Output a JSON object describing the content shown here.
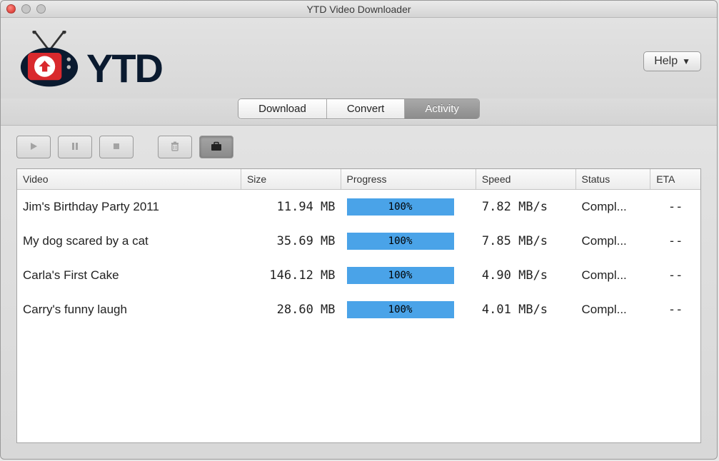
{
  "window": {
    "title": "YTD Video Downloader"
  },
  "header": {
    "brand": "YTD",
    "help_label": "Help"
  },
  "tabs": [
    {
      "label": "Download"
    },
    {
      "label": "Convert"
    },
    {
      "label": "Activity",
      "active": true
    }
  ],
  "toolbar": {
    "play": "play-icon",
    "pause": "pause-icon",
    "stop": "stop-icon",
    "trash": "trash-icon",
    "clear": "clear-all-icon"
  },
  "table": {
    "headers": {
      "video": "Video",
      "size": "Size",
      "progress": "Progress",
      "speed": "Speed",
      "status": "Status",
      "eta": "ETA"
    },
    "rows": [
      {
        "video": "Jim's Birthday Party 2011",
        "size": "11.94 MB",
        "progress": "100%",
        "speed": "7.82 MB/s",
        "status": "Compl...",
        "eta": "--"
      },
      {
        "video": "My dog scared by a cat",
        "size": "35.69 MB",
        "progress": "100%",
        "speed": "7.85 MB/s",
        "status": "Compl...",
        "eta": "--"
      },
      {
        "video": "Carla's First Cake",
        "size": "146.12 MB",
        "progress": "100%",
        "speed": "4.90 MB/s",
        "status": "Compl...",
        "eta": "--"
      },
      {
        "video": "Carry's funny laugh",
        "size": "28.60 MB",
        "progress": "100%",
        "speed": "4.01 MB/s",
        "status": "Compl...",
        "eta": "--"
      }
    ]
  }
}
